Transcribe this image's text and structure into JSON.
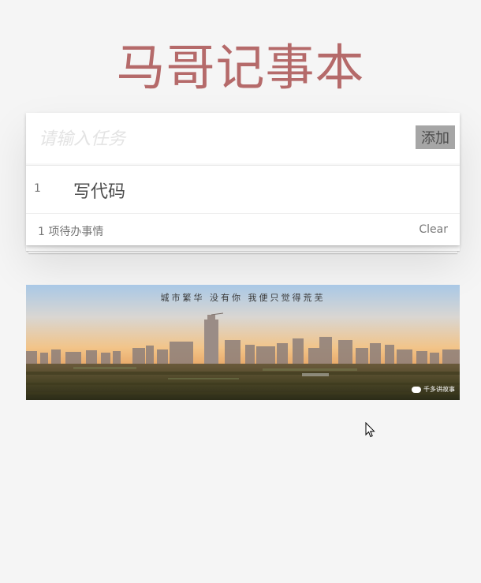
{
  "app": {
    "title": "马哥记事本"
  },
  "header": {
    "input_placeholder": "请输入任务",
    "input_value": "",
    "add_label": "添加"
  },
  "todos": [
    {
      "index": "1",
      "label": "写代码"
    }
  ],
  "footer": {
    "count_label": "1 项待办事情",
    "clear_label": "Clear"
  },
  "banner": {
    "caption": "城市繁华 没有你 我便只觉得荒芜",
    "watermark": "千多讲故事"
  },
  "colors": {
    "title": "#b56a6a",
    "add_button_bg": "#a6a6a6",
    "page_bg": "#f5f5f5"
  }
}
